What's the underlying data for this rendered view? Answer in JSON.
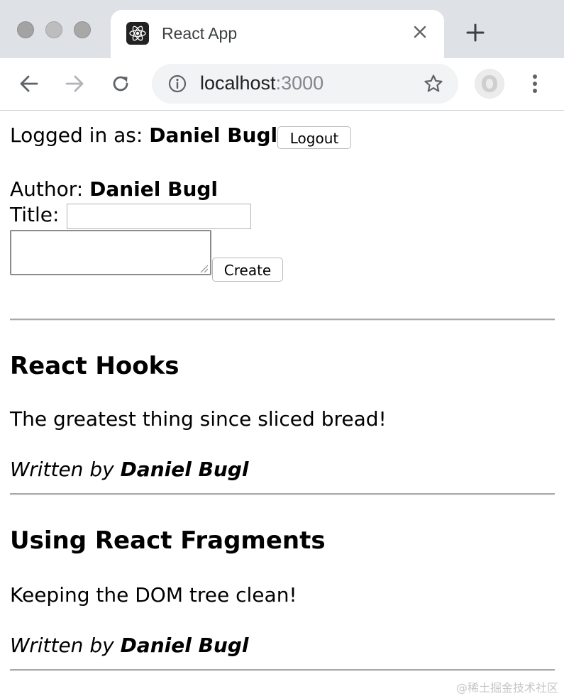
{
  "browser": {
    "tab_title": "React App",
    "url_host": "localhost",
    "url_port": ":3000",
    "icons": [
      "react-favicon-icon",
      "close-icon",
      "plus-icon",
      "back-arrow-icon",
      "forward-arrow-icon",
      "reload-icon",
      "info-icon",
      "star-icon",
      "profile-avatar-icon",
      "more-vert-icon"
    ]
  },
  "user": {
    "logged_in_prefix": "Logged in as: ",
    "username": "Daniel Bugl",
    "logout_label": "Logout"
  },
  "create_post": {
    "author_prefix": "Author: ",
    "author_name": "Daniel Bugl",
    "title_label": "Title:",
    "title_value": "",
    "content_value": "",
    "create_label": "Create"
  },
  "posts": [
    {
      "title": "React Hooks",
      "content": "The greatest thing since sliced bread!",
      "written_by_prefix": "Written by ",
      "author": "Daniel Bugl"
    },
    {
      "title": "Using React Fragments",
      "content": "Keeping the DOM tree clean!",
      "written_by_prefix": "Written by ",
      "author": "Daniel Bugl"
    }
  ],
  "watermark": "@稀土掘金技术社区",
  "colors": {
    "tabstrip": "#dee1e6",
    "omnibox": "#f1f3f4",
    "divider": "#a9a9a9"
  }
}
